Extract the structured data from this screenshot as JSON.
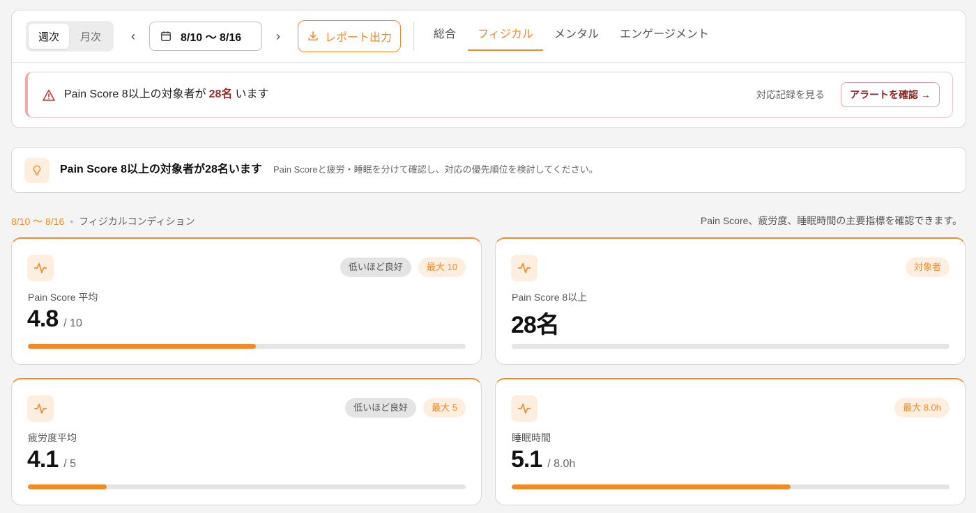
{
  "toolbar": {
    "period": {
      "weekly": "週次",
      "monthly": "月次"
    },
    "prev_symbol": "‹",
    "next_symbol": "›",
    "date_range": "8/10 〜 8/16",
    "report_label": "レポート出力",
    "tabs": [
      "総合",
      "フィジカル",
      "メンタル",
      "エンゲージメント"
    ],
    "active_tab": "フィジカル"
  },
  "alert": {
    "text_before": "Pain Score 8以上の対象者が",
    "count": "28名",
    "text_after": "います",
    "history_link": "対応記録を見る",
    "confirm_label": "アラートを確認 →"
  },
  "insight": {
    "title": "Pain Score 8以上の対象者が28名います",
    "description": "Pain Scoreと疲労・睡眠を分けて確認し、対応の優先順位を検討してください。"
  },
  "section": {
    "range": "8/10 〜 8/16",
    "dot": "•",
    "label": "フィジカルコンディション",
    "note": "Pain Score、疲労度、睡眠時間の主要指標を確認できます。"
  },
  "metrics": [
    {
      "label": "Pain Score 平均",
      "value": "4.8",
      "max": "/ 10",
      "badges": [
        "低いほど良好",
        "最大 10"
      ],
      "progress": 0.52
    },
    {
      "label": "Pain Score 8以上",
      "value": "28名",
      "max": "",
      "badges": [
        "対象者"
      ],
      "progress": 0
    },
    {
      "label": "疲労度平均",
      "value": "4.1",
      "max": "/ 5",
      "badges": [
        "低いほど良好",
        "最大 5"
      ],
      "progress": 0.18
    },
    {
      "label": "睡眠時間",
      "value": "5.1",
      "max": "/ 8.0h",
      "badges": [
        "最大 8.0h"
      ],
      "progress": 0.637
    }
  ],
  "colors": {
    "accent": "#f28a26",
    "alert": "#9b2c2c",
    "track": "#e4e4e4"
  },
  "icons": [
    "calendar-icon",
    "download-icon",
    "warning-icon",
    "lightbulb-icon",
    "pulse-icon"
  ]
}
